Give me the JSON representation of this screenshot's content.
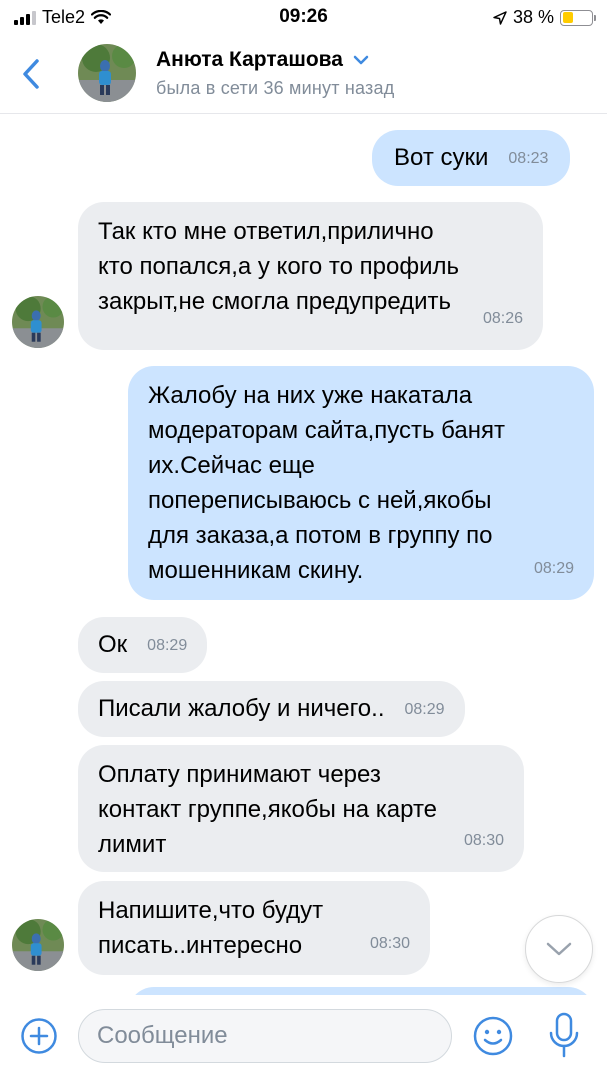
{
  "status_bar": {
    "carrier": "Tele2",
    "time": "09:26",
    "battery": "38 %",
    "battery_level": 0.38
  },
  "header": {
    "name": "Анюта Карташова",
    "status": "была в сети 36 минут назад"
  },
  "messages": [
    {
      "dir": "out",
      "text": "Вот суки",
      "time": "08:23"
    },
    {
      "dir": "in",
      "text": "Так кто мне ответил,прилично\nкто попался,а у кого то профиль\nзакрыт,не смогла предупредить",
      "time": "08:26"
    },
    {
      "dir": "out",
      "text": "Жалобу на них уже накатала\nмодераторам сайта,пусть банят\nих.Сейчас еще\nпопереписываюсь с ней,якобы\nдля заказа,а потом в группу по\nмошенникам скину.",
      "time": "08:29"
    },
    {
      "dir": "in",
      "text": "Ок",
      "time": "08:29"
    },
    {
      "dir": "in",
      "text": "Писали жалобу и ничего..",
      "time": "08:29"
    },
    {
      "dir": "in",
      "text": "Оплату принимают через\nконтакт группе,якобы на карте\nлимит",
      "time": "08:30"
    },
    {
      "dir": "in",
      "text": "Напишите,что будут\nписать..интересно",
      "time": "08:30"
    }
  ],
  "composer": {
    "placeholder": "Сообщение"
  },
  "colors": {
    "accent": "#3f8ae0",
    "incoming_bubble": "#ebedf0",
    "outgoing_bubble": "#cce4ff",
    "secondary_text": "#818c99"
  },
  "icons": {
    "back": "chevron-left-icon",
    "dropdown": "chevron-down-icon",
    "scroll_down": "chevron-down-icon",
    "attach": "plus-circle-icon",
    "emoji": "smile-icon",
    "voice": "microphone-icon",
    "location": "location-arrow-icon",
    "wifi": "wifi-icon"
  }
}
